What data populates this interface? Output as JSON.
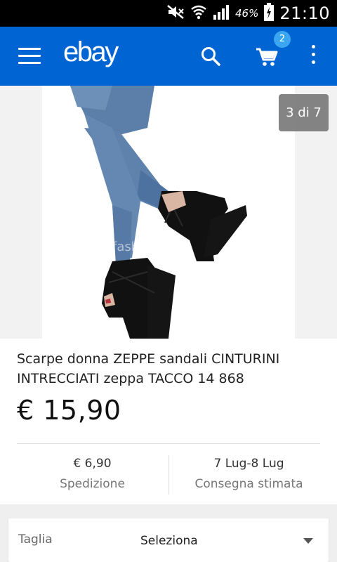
{
  "status_bar": {
    "battery_percent": "46%",
    "time": "21:10",
    "icons": [
      "mute-icon",
      "wifi-icon",
      "signal-icon",
      "battery-icon"
    ]
  },
  "app_bar": {
    "logo": "ebay",
    "cart_count": "2",
    "icons": [
      "menu-icon",
      "search-icon",
      "cart-icon",
      "more-vert-icon"
    ],
    "color": "#0064d2"
  },
  "gallery": {
    "counter": "3 di 7",
    "watermark": "fashion"
  },
  "product": {
    "title": "Scarpe donna ZEPPE sandali CINTURINI INTRECCIATI zeppa TACCO 14 868",
    "price": "€ 15,90"
  },
  "shipping": {
    "cost": "€ 6,90",
    "cost_label": "Spedizione",
    "delivery": "7 Lug-8 Lug",
    "delivery_label": "Consegna stimata"
  },
  "variation": {
    "label": "Taglia",
    "value": "Seleziona"
  }
}
